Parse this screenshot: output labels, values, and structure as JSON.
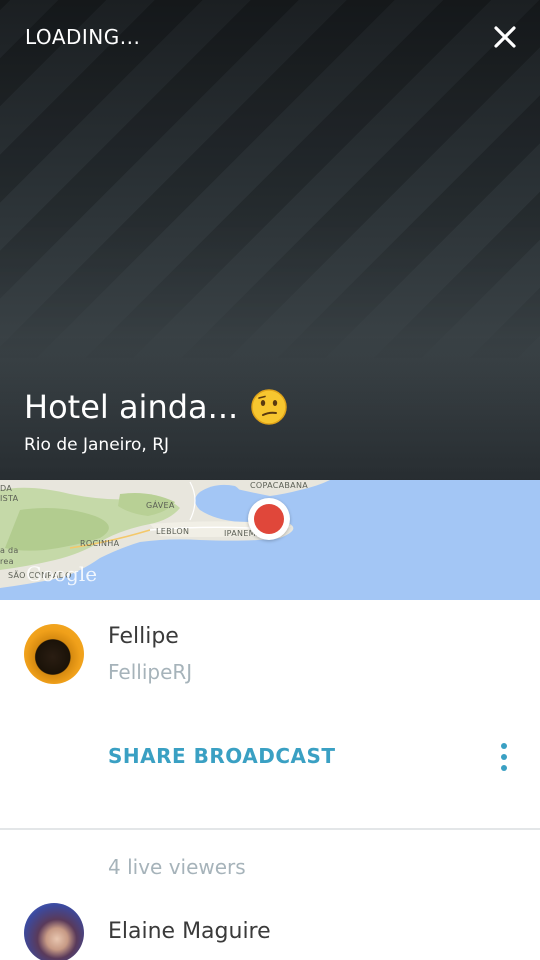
{
  "header": {
    "status": "LOADING...",
    "close_icon": "close-icon"
  },
  "broadcast": {
    "title": "Hotel ainda...",
    "emoji": "confused-face-icon",
    "location": "Rio de Janeiro, RJ"
  },
  "map": {
    "labels": [
      "COPACABANA",
      "GÁVEA",
      "LEBLON",
      "IPANEMA",
      "ROCINHA",
      "DA",
      "ISTA",
      "a da",
      "rea",
      "SÃO CONRADO"
    ],
    "attribution": "Google",
    "pin_color": "#e0473a",
    "water_color": "#a3c6f5"
  },
  "broadcaster": {
    "name": "Fellipe",
    "handle": "FellipeRJ"
  },
  "actions": {
    "share_label": "SHARE BROADCAST",
    "more_icon": "more-vertical-icon",
    "accent_color": "#3aa0c3"
  },
  "viewers": {
    "count_label": "4 live viewers",
    "list": [
      {
        "name": "Elaine Maguire"
      }
    ]
  }
}
